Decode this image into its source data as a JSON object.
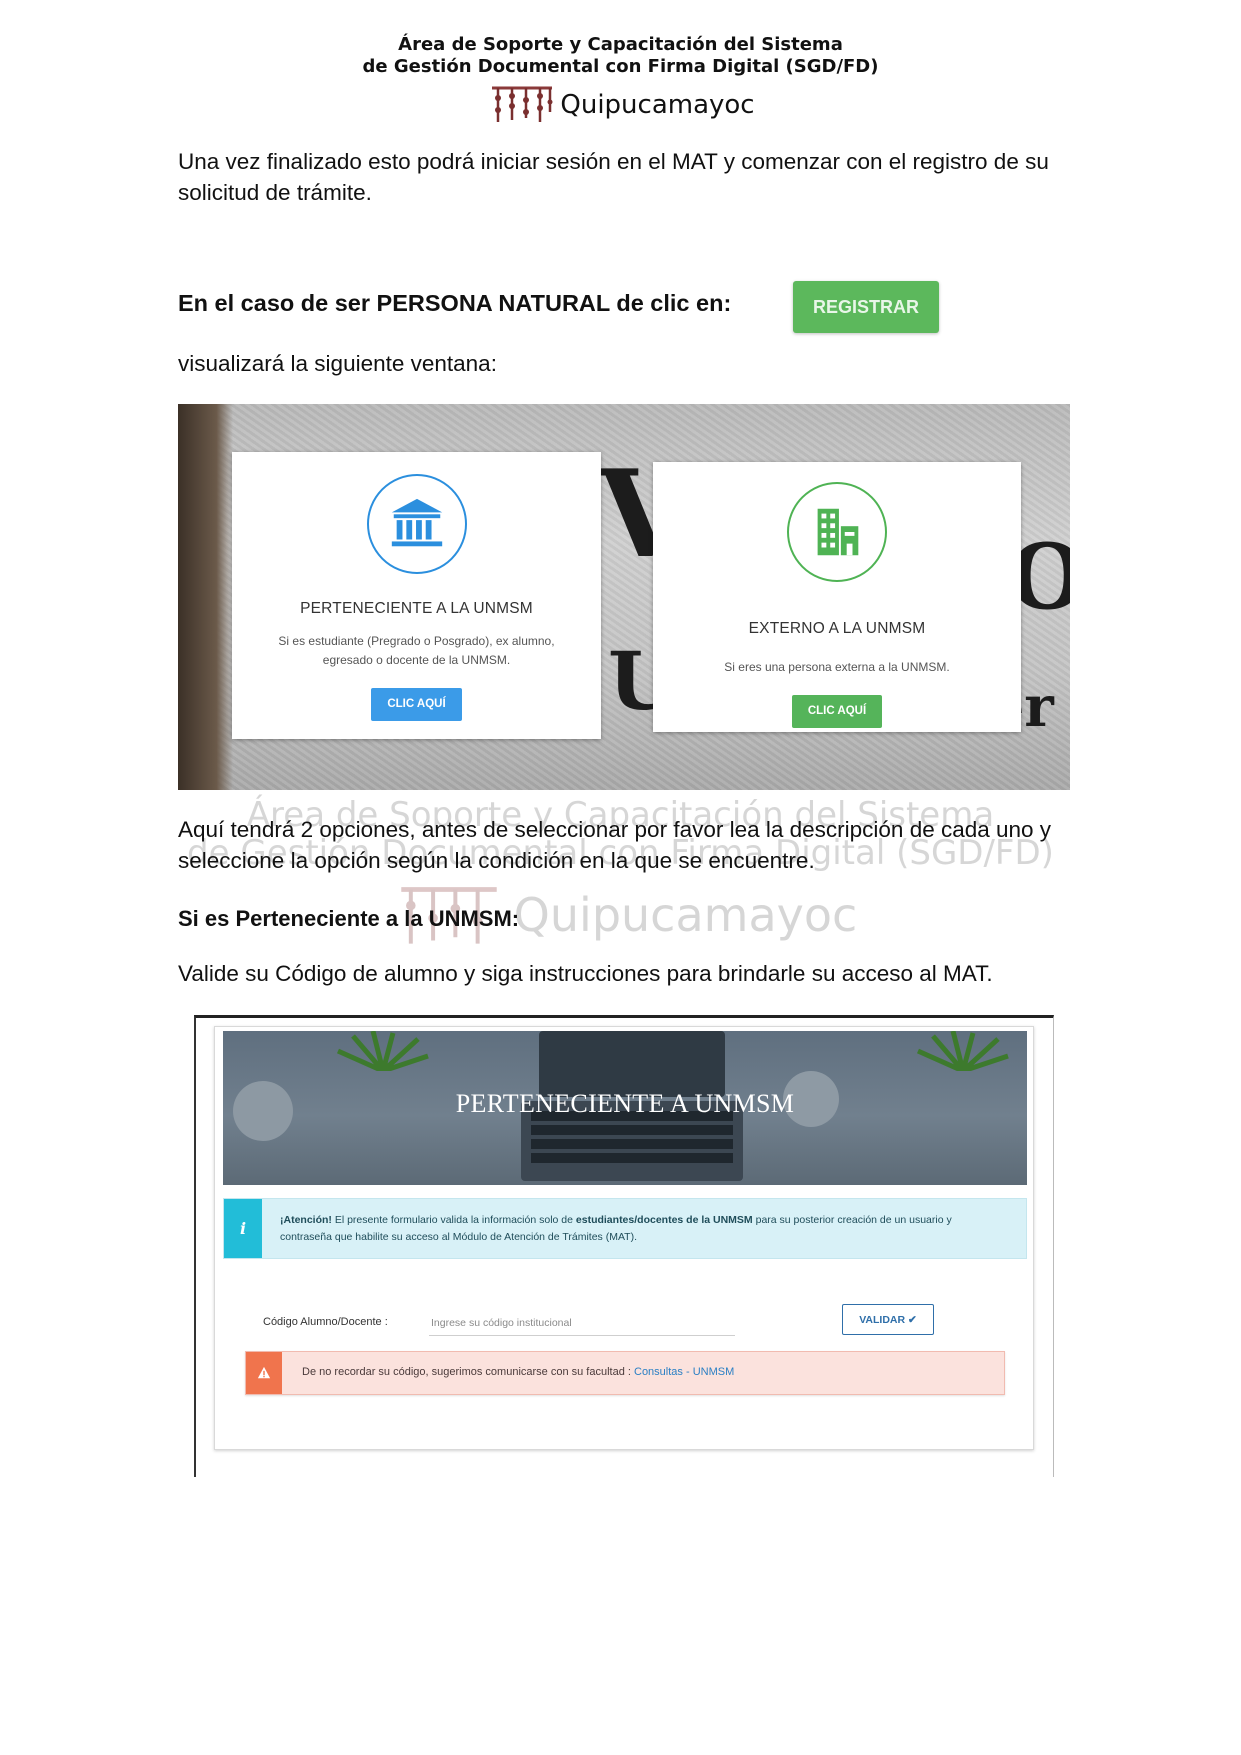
{
  "header": {
    "line1": "Área de Soporte y Capacitación del Sistema",
    "line2": "de Gestión Documental con Firma Digital (SGD/FD)",
    "logo_text": "Quipucamayoc"
  },
  "paragraphs": {
    "p1": "Una vez finalizado esto podrá iniciar sesión en el MAT y comenzar con el registro de su solicitud de trámite.",
    "natural_heading": "En el caso de ser PERSONA NATURAL de clic en:",
    "registrar_button": "REGISTRAR",
    "p2": "visualizará la siguiente ventana:",
    "p3": "Aquí tendrá 2 opciones, antes de seleccionar por favor lea la descripción de cada uno y seleccione la opción según la condición en la que se encuentre.",
    "perteneciente_heading": "Si es Perteneciente a la UNMSM:",
    "p4": "Valide su Código de alumno y siga instrucciones para brindarle su acceso al MAT."
  },
  "watermark": {
    "line1": "Área de Soporte y Capacitación del Sistema",
    "line2": "de Gestión Documental con Firma Digital (SGD/FD)",
    "logo_text": "Quipucamayoc"
  },
  "screenshot1": {
    "cards": [
      {
        "icon": "institution-icon",
        "title": "PERTENECIENTE A LA UNMSM",
        "description": "Si es estudiante (Pregrado o Posgrado), ex alumno, egresado o docente de la UNMSM.",
        "button": "CLIC AQUÍ",
        "accent": "#2b8fde"
      },
      {
        "icon": "building-icon",
        "title": "EXTERNO A LA UNMSM",
        "description": "Si eres una persona externa a la UNMSM.",
        "button": "CLIC AQUÍ",
        "accent": "#4fb354"
      }
    ]
  },
  "screenshot2": {
    "banner_title": "PERTENECIENTE A UNMSM",
    "info_alert": {
      "icon": "info-icon",
      "lead": "¡Atención!",
      "text_before": " El presente formulario valida la información solo de ",
      "bold": "estudiantes/docentes de la UNMSM",
      "text_after": " para su posterior creación de un usuario y contraseña que habilite su acceso al Módulo de Atención de Trámites (MAT)."
    },
    "code_label": "Código Alumno/Docente :",
    "code_placeholder": "Ingrese su código institucional",
    "validar_button": "VALIDAR ✔",
    "warning_alert": {
      "icon": "warning-icon",
      "text": "De no recordar su código, sugerimos comunicarse con su facultad : ",
      "link": "Consultas - UNMSM"
    }
  },
  "colors": {
    "registrar_green": "#5cb85c",
    "clic_blue": "#3b9be8",
    "clic_green": "#55b45a",
    "info_accent": "#22bdd8",
    "warning_accent": "#f0744d"
  }
}
